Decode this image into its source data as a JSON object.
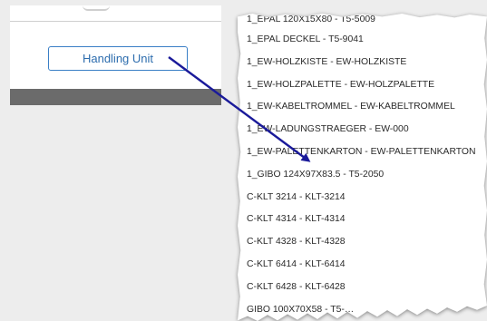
{
  "handling_unit_button": {
    "label": "Handling Unit"
  },
  "dropdown": {
    "items": [
      "1_EPAL 120X15X80 - T5-5009",
      "1_EPAL DECKEL - T5-9041",
      "1_EW-HOLZKISTE - EW-HOLZKISTE",
      "1_EW-HOLZPALETTE - EW-HOLZPALETTE",
      "1_EW-KABELTROMMEL - EW-KABELTROMMEL",
      "1_EW-LADUNGSTRAEGER - EW-000",
      "1_EW-PALETTENKARTON - EW-PALETTENKARTON",
      "1_GIBO 124X97X83.5 - T5-2050",
      "C-KLT 3214 - KLT-3214",
      "C-KLT 4314 - KLT-4314",
      "C-KLT 4328 - KLT-4328",
      "C-KLT 6414 - KLT-6414",
      "C-KLT 6428 - KLT-6428",
      "GIBO 100X70X58 - T5-…"
    ]
  },
  "colors": {
    "button_border": "#3a7fc6",
    "button_text": "#2d6dae",
    "arrow": "#1a1a9a",
    "footer_bar": "#6b6b6b"
  },
  "icons": {
    "annotation_arrow": "arrow-icon"
  }
}
